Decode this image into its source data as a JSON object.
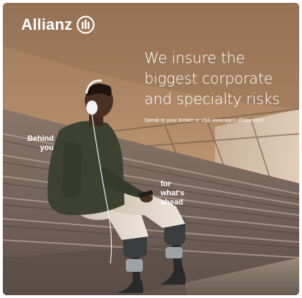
{
  "brand": {
    "name": "Allianz",
    "logo_icon": "allianz-eagle-bars-icon"
  },
  "headline": {
    "lines": [
      "We insure the",
      "biggest corporate",
      "and specialty risks"
    ]
  },
  "cta": {
    "text": "Speak to your broker or visit www.agcs.allianz.com"
  },
  "tagline_left": {
    "lines": [
      "Behind",
      "you"
    ]
  },
  "tagline_right": {
    "lines": [
      "for",
      "what's",
      "ahead"
    ]
  },
  "colors": {
    "text": "#ffffff",
    "roof": "#a88262",
    "stands": "#7e6a5c",
    "jacket": "#3d4230",
    "skin": "#4a3023",
    "pants": "#e0d5c8"
  }
}
